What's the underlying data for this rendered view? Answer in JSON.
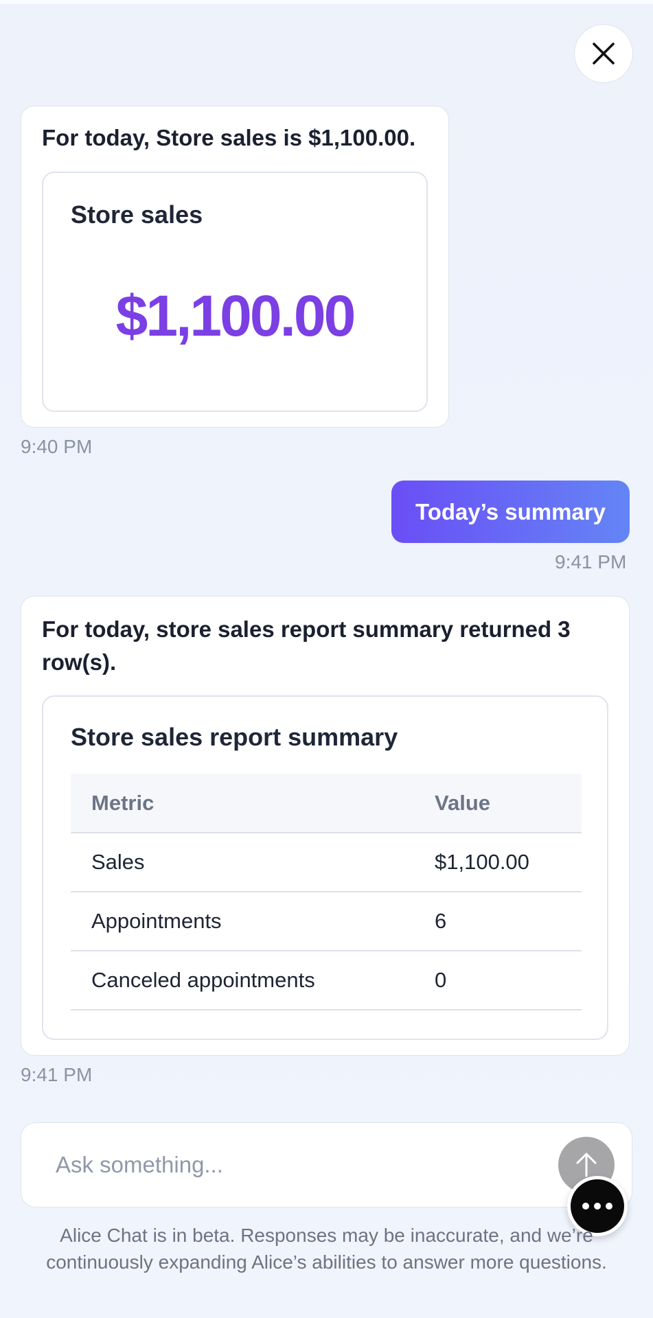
{
  "messages": [
    {
      "role": "assistant",
      "text": "For today, Store sales is $1,100.00.",
      "card": {
        "title": "Store sales",
        "value": "$1,100.00"
      },
      "time": "9:40 PM"
    },
    {
      "role": "user",
      "text": "Today’s summary",
      "time": "9:41 PM"
    },
    {
      "role": "assistant",
      "text": "For today, store sales report summary returned 3 row(s).",
      "card": {
        "title": "Store sales report summary",
        "table": {
          "headers": [
            "Metric",
            "Value"
          ],
          "rows": [
            [
              "Sales",
              "$1,100.00"
            ],
            [
              "Appointments",
              "6"
            ],
            [
              "Canceled appointments",
              "0"
            ]
          ]
        }
      },
      "time": "9:41 PM"
    }
  ],
  "composer": {
    "placeholder": "Ask something..."
  },
  "disclaimer": "Alice Chat is in beta. Responses may be inaccurate, and we’re continuously expanding Alice’s abilities to answer more questions.",
  "icons": {
    "close": "close-icon",
    "send": "arrow-up-icon",
    "more": "more-dots-icon"
  },
  "colors": {
    "accent_purple": "#7b3fe4",
    "user_bubble_start": "#6a4ef6",
    "user_bubble_end": "#6485f5",
    "send_button": "#a6a6a8",
    "fab": "#0a0a0a"
  }
}
